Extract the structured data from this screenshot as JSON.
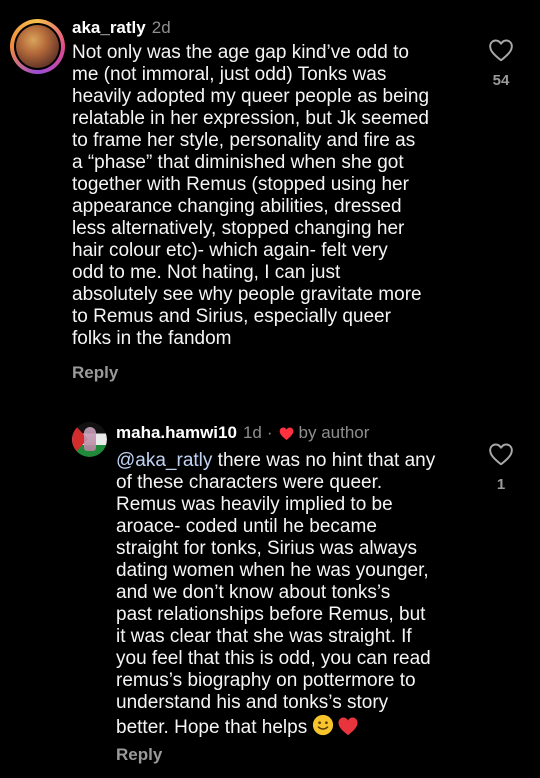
{
  "comments": [
    {
      "username": "aka_ratly",
      "time": "2d",
      "text": "Not only was the age gap kind’ve odd to\nme (not immoral, just odd) Tonks was\nheavily adopted my queer people as being\nrelatable in her expression, but Jk seemed\nto frame her style, personality and fire as\na “phase” that diminished when she got\ntogether with Remus (stopped using her\nappearance changing abilities, dressed\nless alternatively, stopped changing her\nhair colour etc)- which again- felt very\nodd to me. Not hating, I can just\nabsolutely see why people gravitate more\nto Remus and Sirius, especially queer\nfolks in the fandom",
      "reply_label": "Reply",
      "like_count": "54",
      "avatar_icon": "profile-avatar"
    },
    {
      "username": "maha.hamwi10",
      "time": "1d",
      "separator": "·",
      "author_label": "by author",
      "mention": "@aka_ratly",
      "text": " there was no hint that any\nof these characters were queer.\nRemus was heavily implied to be\naroace- coded until he became\nstraight for tonks, Sirius was always\ndating women when he was younger,\nand we don’t know about tonks’s\npast relationships before Remus, but\nit was clear that she was straight. If\nyou feel that this is odd, you can read\nremus’s biography on pottermore to\nunderstand his and tonks’s story\nbetter. Hope that helps ",
      "emojis": [
        "slightly-smiling-face",
        "red-heart"
      ],
      "reply_label": "Reply",
      "like_count": "1",
      "avatar_icon": "profile-avatar"
    }
  ],
  "colors": {
    "background": "#000000",
    "text": "#f5f5f5",
    "secondary": "#8e8e8e",
    "mention": "#c1d3f5",
    "heart_red": "#ff3040"
  }
}
